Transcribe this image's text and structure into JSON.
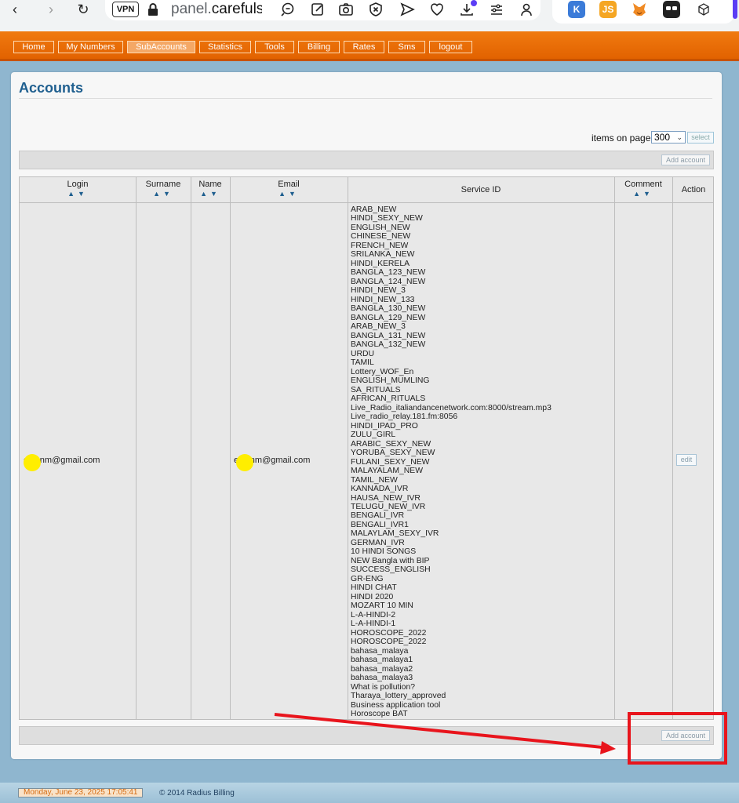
{
  "browser": {
    "vpn": "VPN",
    "url_prefix": "panel.",
    "url_host": "carefulsup"
  },
  "nav": {
    "items": [
      {
        "label": "Home"
      },
      {
        "label": "My Numbers"
      },
      {
        "label": "SubAccounts",
        "active": true
      },
      {
        "label": "Statistics"
      },
      {
        "label": "Tools"
      },
      {
        "label": "Billing"
      },
      {
        "label": "Rates"
      },
      {
        "label": "Sms"
      },
      {
        "label": "logout"
      }
    ]
  },
  "page": {
    "title": "Accounts",
    "items_on_page_label": "items on page:",
    "items_on_page_value": "300",
    "select_button": "select",
    "add_account_button": "Add account"
  },
  "table": {
    "headers": {
      "login": "Login",
      "surname": "Surname",
      "name": "Name",
      "email": "Email",
      "service_id": "Service ID",
      "comment": "Comment",
      "action": "Action"
    },
    "sort_glyph": "▲▼",
    "row": {
      "login": "e vbnm@gmail.com",
      "surname": "",
      "name": "",
      "email": "e vbnm@gmail.com",
      "comment": "",
      "action": "edit",
      "services": [
        "ARAB_NEW",
        "HINDI_SEXY_NEW",
        "ENGLISH_NEW",
        "CHINESE_NEW",
        "FRENCH_NEW",
        "SRILANKA_NEW",
        "HINDI_KERELA",
        "BANGLA_123_NEW",
        "BANGLA_124_NEW",
        "HINDI_NEW_3",
        "HINDI_NEW_133",
        "BANGLA_130_NEW",
        "BANGLA_129_NEW",
        "ARAB_NEW_3",
        "BANGLA_131_NEW",
        "BANGLA_132_NEW",
        "URDU",
        "TAMIL",
        "Lottery_WOF_En",
        "ENGLISH_MUMLING",
        "SA_RITUALS",
        "AFRICAN_RITUALS",
        "Live_Radio_italiandancenetwork.com:8000/stream.mp3",
        "Live_radio_relay.181.fm:8056",
        "HINDI_IPAD_PRO",
        "ZULU_GIRL",
        "ARABIC_SEXY_NEW",
        "YORUBA_SEXY_NEW",
        "FULANI_SEXY_NEW",
        "MALAYALAM_NEW",
        "TAMIL_NEW",
        "KANNADA_IVR",
        "HAUSA_NEW_IVR",
        "TELUGU_NEW_IVR",
        "BENGALI_IVR",
        "BENGALI_IVR1",
        "MALAYLAM_SEXY_IVR",
        "GERMAN_IVR",
        "10 HINDI SONGS",
        "NEW Bangla with BIP",
        "SUCCESS_ENGLISH",
        "GR-ENG",
        "HINDI CHAT",
        "HINDI 2020",
        "MOZART 10 MIN",
        "L-A-HINDI-2",
        "L-A-HINDI-1",
        "HOROSCOPE_2022",
        "HOROSCOPE_2022",
        "bahasa_malaya",
        "bahasa_malaya1",
        "bahasa_malaya2",
        "bahasa_malaya3",
        "What is pollution?",
        "Tharaya_lottery_approved",
        "Business application tool",
        "Horoscope BAT"
      ]
    }
  },
  "footer": {
    "datetime": "Monday, June 23, 2025   17:05:41",
    "copyright": "© 2014 Radius Billing"
  },
  "colors": {
    "nav_orange": "#e26200",
    "title_blue": "#1f5f8f",
    "annotation_red": "#e8141c",
    "redaction_yellow": "#ffee00"
  }
}
